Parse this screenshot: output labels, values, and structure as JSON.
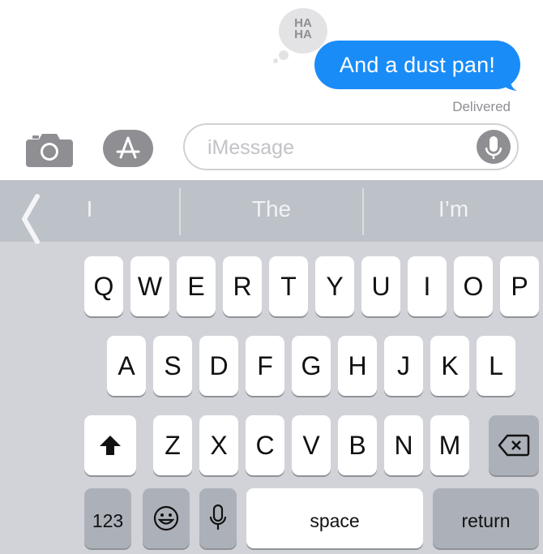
{
  "conversation": {
    "message_text": "And a dust pan!",
    "tapback_label": "HA HA",
    "status": "Delivered",
    "bubble_color": "#1a8cf8"
  },
  "compose": {
    "camera_icon": "camera-icon",
    "apps_icon": "app-store-icon",
    "input_placeholder": "iMessage",
    "input_value": "",
    "mic_icon": "microphone-icon"
  },
  "predictions": [
    "I",
    "The",
    "I’m"
  ],
  "keyboard": {
    "row1": [
      "Q",
      "W",
      "E",
      "R",
      "T",
      "Y",
      "U",
      "I",
      "O",
      "P"
    ],
    "row2": [
      "A",
      "S",
      "D",
      "F",
      "G",
      "H",
      "J",
      "K",
      "L"
    ],
    "row3": [
      "Z",
      "X",
      "C",
      "V",
      "B",
      "N",
      "M"
    ],
    "numbers_label": "123",
    "space_label": "space",
    "return_label": "return",
    "shift_icon": "shift-icon",
    "delete_icon": "delete-icon",
    "emoji_icon": "emoji-icon",
    "dictation_icon": "microphone-icon",
    "collapse_icon": "chevron-left-icon"
  }
}
